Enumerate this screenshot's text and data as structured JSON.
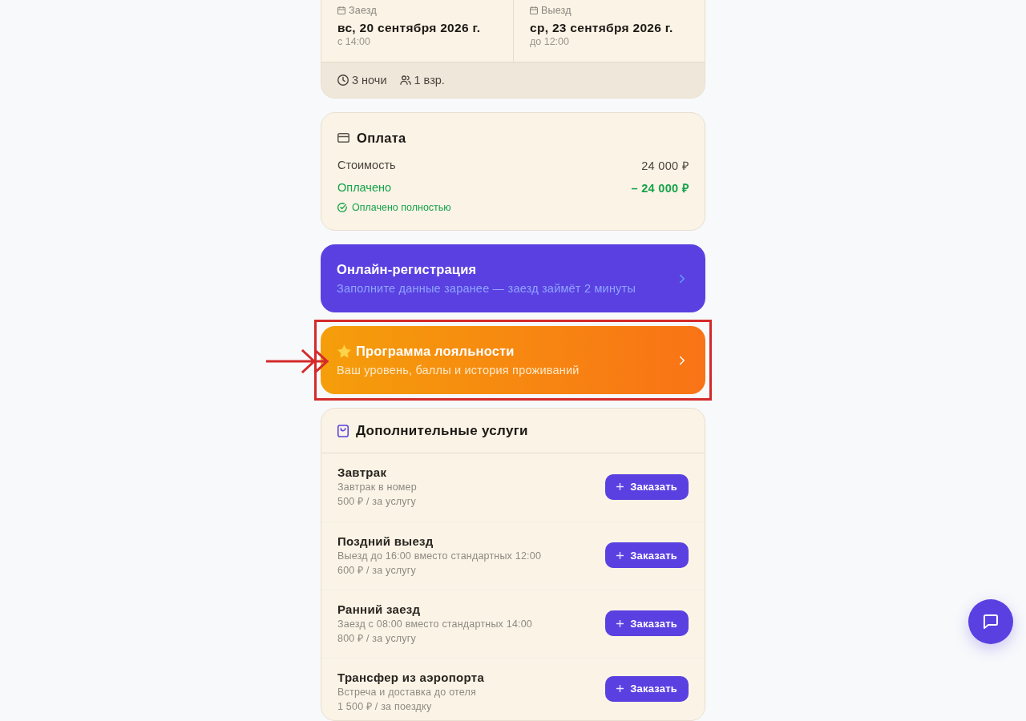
{
  "stay": {
    "dates": [
      {
        "label": "Заезд",
        "date": "вс, 20 сентября 2026 г.",
        "time": "с 14:00"
      },
      {
        "label": "Выезд",
        "date": "ср, 23 сентября 2026 г.",
        "time": "до 12:00"
      }
    ],
    "summary": [
      {
        "kind": "nights",
        "text": "3 ночи"
      },
      {
        "kind": "guests",
        "text": "1 взр."
      }
    ]
  },
  "payment": {
    "title": "Оплата",
    "rows": [
      {
        "kind": "cost",
        "label": "Стоимость",
        "amount": "24 000 ₽"
      },
      {
        "kind": "paid",
        "label": "Оплачено",
        "amount": "– 24 000 ₽"
      }
    ],
    "status": "Оплачено полностью"
  },
  "actions": [
    {
      "kind": "checkin",
      "title": "Онлайн-регистрация",
      "subtitle": "Заполните данные заранее — заезд займёт 2 минуты",
      "highlighted": false
    },
    {
      "kind": "loyalty",
      "title": "Программа лояльности",
      "subtitle": "Ваш уровень, баллы и история проживаний",
      "highlighted": true
    }
  ],
  "services": {
    "title": "Дополнительные услуги",
    "items": [
      {
        "name": "Завтрак",
        "description": "Завтрак в номер",
        "price": "500 ₽ / за услугу",
        "button": "Заказать"
      },
      {
        "name": "Поздний выезд",
        "description": "Выезд до 16:00 вместо стандартных 12:00",
        "price": "600 ₽ / за услугу",
        "button": "Заказать"
      },
      {
        "name": "Ранний заезд",
        "description": "Заезд с 08:00 вместо стандартных 14:00",
        "price": "800 ₽ / за услугу",
        "button": "Заказать"
      },
      {
        "name": "Трансфер из аэропорта",
        "description": "Встреча и доставка до отеля",
        "price": "1 500 ₽ / за поездку",
        "button": "Заказать"
      }
    ]
  }
}
